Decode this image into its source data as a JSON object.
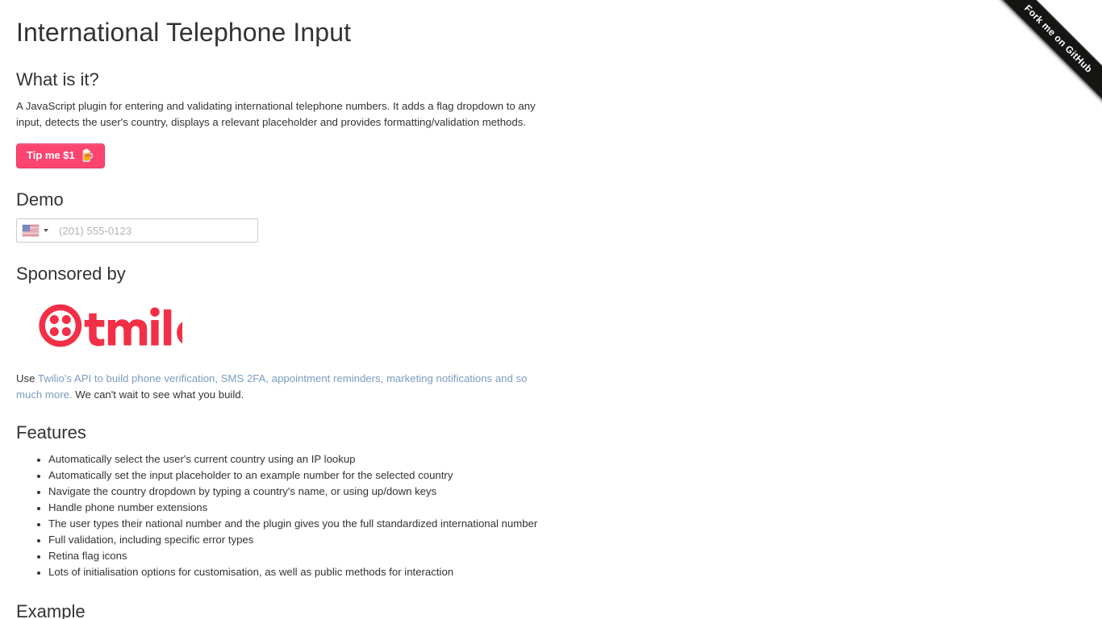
{
  "colors": {
    "text": "#333333",
    "link": "#7a9cc0",
    "tip_button_bg": "#fb4570",
    "twilio_red": "#f22f46",
    "ribbon_bg": "#151513",
    "input_border": "#cccccc",
    "placeholder": "#b3b3b3"
  },
  "ribbon": {
    "label": "Fork me on GitHub"
  },
  "header": {
    "title": "International Telephone Input"
  },
  "what_is_it": {
    "heading": "What is it?",
    "paragraph": "A JavaScript plugin for entering and validating international telephone numbers. It adds a flag dropdown to any input, detects the user's country, displays a relevant placeholder and provides formatting/validation methods."
  },
  "tip": {
    "label": "Tip me $1",
    "icon": "beer-mug-icon",
    "glyph": "🍺"
  },
  "demo": {
    "heading": "Demo",
    "input": {
      "value": "",
      "placeholder": "(201) 555-0123",
      "selected_country": "United States",
      "flag_icon": "flag-us-icon",
      "dropdown_icon": "chevron-down-icon"
    }
  },
  "sponsor": {
    "heading": "Sponsored by",
    "logo_name": "twilio-logo",
    "logo_text": "twilio",
    "paragraph_prefix": "Use ",
    "link_text": "Twilio's API to build phone verification, SMS 2FA, appointment reminders, marketing notifications and so much more.",
    "paragraph_suffix": " We can't wait to see what you build."
  },
  "features": {
    "heading": "Features",
    "items": [
      "Automatically select the user's current country using an IP lookup",
      "Automatically set the input placeholder to an example number for the selected country",
      "Navigate the country dropdown by typing a country's name, or using up/down keys",
      "Handle phone number extensions",
      "The user types their national number and the plugin gives you the full standardized international number",
      "Full validation, including specific error types",
      "Retina flag icons",
      "Lots of initialisation options for customisation, as well as public methods for interaction"
    ]
  },
  "next_section": {
    "heading": "Example"
  }
}
